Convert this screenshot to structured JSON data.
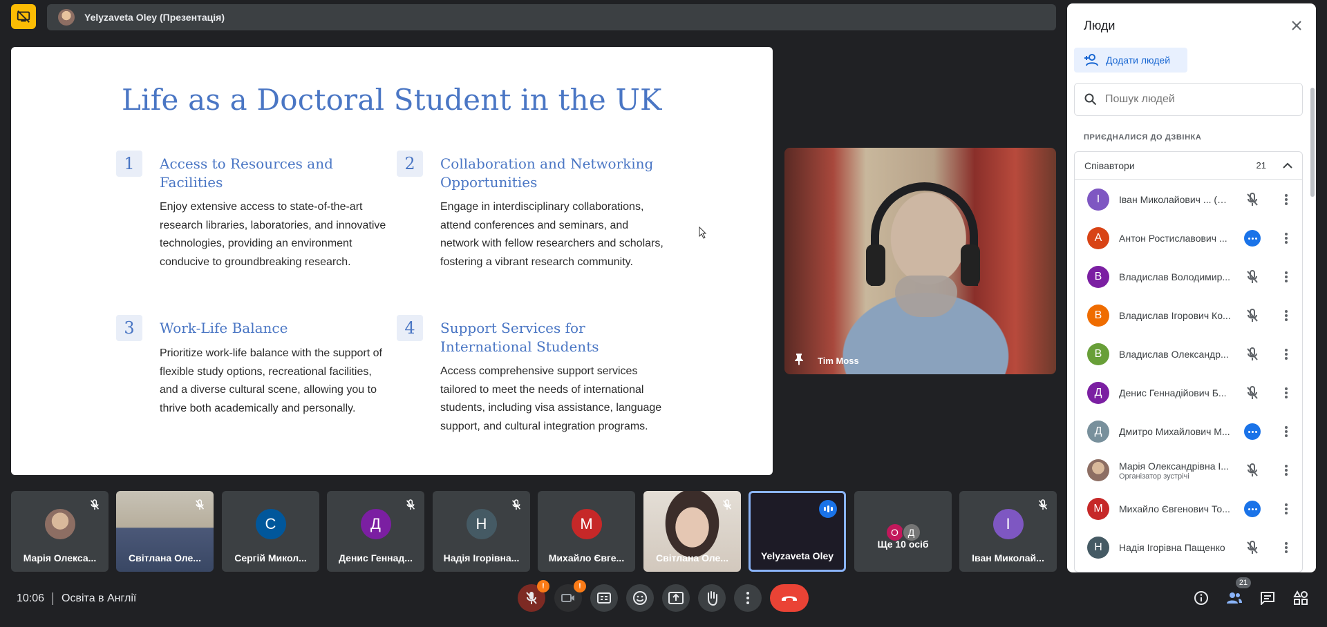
{
  "presentation_bar": {
    "title": "Yelyzaveta Oley (Презентація)"
  },
  "slide": {
    "title": "Life as a Doctoral Student in the UK",
    "cards": [
      {
        "number": "1",
        "heading_lines": [
          "Access to Resources and",
          "Facilities"
        ],
        "body": "Enjoy extensive access to state-of-the-art research libraries, laboratories, and innovative technologies, providing an environment conducive to groundbreaking research."
      },
      {
        "number": "2",
        "heading_lines": [
          "Collaboration and Networking",
          "Opportunities"
        ],
        "body": "Engage in interdisciplinary collaborations, attend conferences and seminars, and network with fellow researchers and scholars, fostering a vibrant research community."
      },
      {
        "number": "3",
        "heading_lines": [
          "Work-Life Balance"
        ],
        "body": "Prioritize work-life balance with the support of flexible study options, recreational facilities, and a diverse cultural scene, allowing you to thrive both academically and personally."
      },
      {
        "number": "4",
        "heading_lines": [
          "Support Services for",
          "International Students"
        ],
        "body": "Access comprehensive support services tailored to meet the needs of international students, including visa assistance, language support, and cultural integration programs."
      }
    ]
  },
  "pinned_tile": {
    "name": "Tim Moss",
    "icon": "pin-icon"
  },
  "people_panel": {
    "title": "Люди",
    "add_button": "Додати людей",
    "search_placeholder": "Пошук людей",
    "section_label": "ПРИЄДНАЛИСЯ ДО ДЗВІНКА",
    "group_label": "Співавтори",
    "group_count": "21",
    "people": [
      {
        "initial": "І",
        "name": "Іван Миколайович ... (Ви)",
        "subtitle": "",
        "color": "#7e57c2",
        "status": "muted"
      },
      {
        "initial": "А",
        "name": "Антон Ростиславович ...",
        "subtitle": "",
        "color": "#d84315",
        "status": "talking"
      },
      {
        "initial": "В",
        "name": "Владислав Володимир...",
        "subtitle": "",
        "color": "#7b1fa2",
        "status": "muted"
      },
      {
        "initial": "В",
        "name": "Владислав Ігорович Ко...",
        "subtitle": "",
        "color": "#ef6c00",
        "status": "muted"
      },
      {
        "initial": "В",
        "name": "Владислав Олександр...",
        "subtitle": "",
        "color": "#689f38",
        "status": "muted"
      },
      {
        "initial": "Д",
        "name": "Денис Геннадійович Б...",
        "subtitle": "",
        "color": "#7b1fa2",
        "status": "muted"
      },
      {
        "initial": "Д",
        "name": "Дмитро Михайлович М...",
        "subtitle": "",
        "color": "#78909c",
        "status": "talking"
      },
      {
        "initial": "",
        "name": "Марія Олександрівна І...",
        "subtitle": "Організатор зустрічі",
        "color": "#8d6e63",
        "status": "muted"
      },
      {
        "initial": "М",
        "name": "Михайло Євгенович То...",
        "subtitle": "",
        "color": "#c62828",
        "status": "talking"
      },
      {
        "initial": "Н",
        "name": "Надія Ігорівна Пащенко",
        "subtitle": "",
        "color": "#455a64",
        "status": "muted"
      }
    ]
  },
  "filmstrip": [
    {
      "name": "Марія Олекса...",
      "initial": "",
      "color": "#8d6e63",
      "kind": "avatar-photo",
      "muted": true
    },
    {
      "name": "Світлана Оле...",
      "initial": "",
      "color": "",
      "kind": "photo1",
      "muted": true
    },
    {
      "name": "Сергій Микол...",
      "initial": "С",
      "color": "#01579b",
      "kind": "avatar",
      "muted": false
    },
    {
      "name": "Денис Геннад...",
      "initial": "Д",
      "color": "#7b1fa2",
      "kind": "avatar",
      "muted": true
    },
    {
      "name": "Надія Ігорівна...",
      "initial": "Н",
      "color": "#455a64",
      "kind": "avatar",
      "muted": true
    },
    {
      "name": "Михайло Євге...",
      "initial": "М",
      "color": "#c62828",
      "kind": "avatar",
      "muted": false
    },
    {
      "name": "Світлана Оле...",
      "initial": "",
      "color": "",
      "kind": "photo2",
      "muted": true
    },
    {
      "name": "Yelyzaveta Oley",
      "initial": "",
      "color": "",
      "kind": "active",
      "muted": false
    },
    {
      "name": "Ще 10 осіб",
      "initial": "",
      "color": "",
      "kind": "more",
      "muted": false,
      "more_initials": [
        "О",
        "Д"
      ],
      "more_colors": [
        "#c2185b",
        "#757575"
      ]
    },
    {
      "name": "Іван Миколай...",
      "initial": "І",
      "color": "#7e57c2",
      "kind": "avatar",
      "muted": true
    }
  ],
  "bottom_bar": {
    "time": "10:06",
    "meeting_name": "Освіта в Англії",
    "people_count": "21",
    "mic_badge": "!",
    "cam_badge": "!"
  },
  "colors": {
    "accent": "#1a73e8",
    "end_call": "#ea4335",
    "slide_heading": "#4a76c4",
    "present_icon": "#fbbc04"
  }
}
